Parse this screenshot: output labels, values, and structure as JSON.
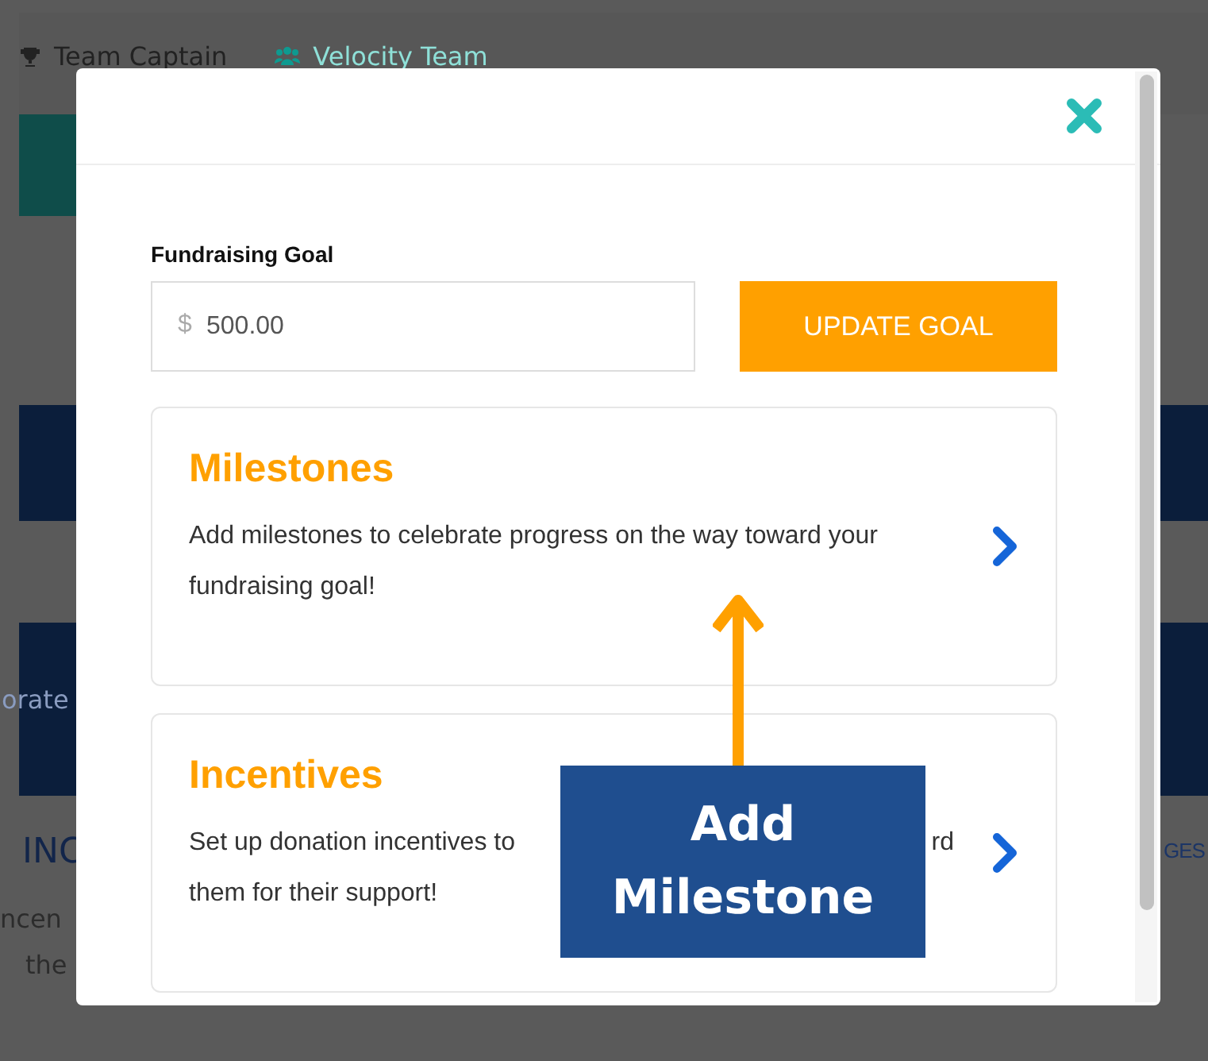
{
  "backdrop": {
    "header_links": [
      {
        "label": "Team Captain",
        "kind": "trophy"
      },
      {
        "label": "Velocity Team",
        "kind": "team"
      }
    ],
    "left_fragments": [
      "orate",
      "INC",
      "ncen",
      "the"
    ],
    "right_fragments": [
      "GES"
    ]
  },
  "modal": {
    "goal": {
      "label": "Fundraising Goal",
      "currency": "$",
      "value": "500.00",
      "button": "UPDATE GOAL"
    },
    "cards": [
      {
        "title": "Milestones",
        "lines": [
          {
            "left": "Add milestones to celebrate progress on the way toward your"
          },
          {
            "left": "fundraising goal!"
          }
        ]
      },
      {
        "title": "Incentives",
        "lines": [
          {
            "left": "Set up donation incentives to",
            "right": "rd"
          },
          {
            "left": "them for their support!"
          }
        ]
      }
    ]
  },
  "annotation": {
    "text": "Add Milestone"
  }
}
